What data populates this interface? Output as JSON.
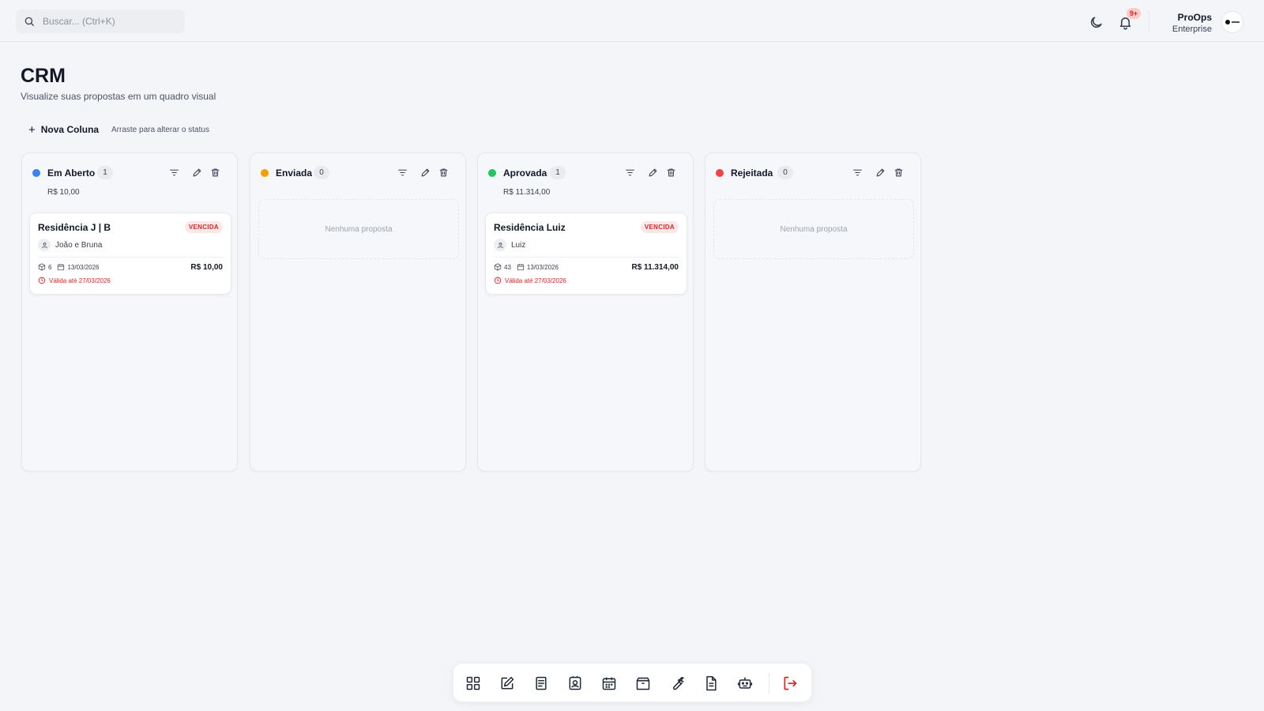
{
  "search": {
    "placeholder": "Buscar... (Ctrl+K)",
    "icon": "search-icon"
  },
  "topbar": {
    "notifications_badge": "9+",
    "user_name": "ProOps",
    "user_plan": "Enterprise"
  },
  "header": {
    "title": "CRM",
    "subtitle": "Visualize suas propostas em um quadro visual",
    "new_column_label": "Nova Coluna",
    "drag_hint": "Arraste para alterar o status"
  },
  "columns": [
    {
      "title": "Em Aberto",
      "count": "1",
      "total": "R$ 10,00",
      "color": "#3b82f6",
      "cards": [
        {
          "title": "Residência J | B",
          "tag": "VENCIDA",
          "client": "João e Bruna",
          "items": "6",
          "date": "13/03/2026",
          "price": "R$ 10,00",
          "valid": "Válida até 27/03/2026"
        }
      ]
    },
    {
      "title": "Enviada",
      "count": "0",
      "total": "",
      "color": "#f59e0b",
      "empty": "Nenhuma proposta",
      "cards": []
    },
    {
      "title": "Aprovada",
      "count": "1",
      "total": "R$ 11.314,00",
      "color": "#22c55e",
      "cards": [
        {
          "title": "Residência Luiz",
          "tag": "VENCIDA",
          "client": "Luiz",
          "items": "43",
          "date": "13/03/2026",
          "price": "R$ 11.314,00",
          "valid": "Válida até 27/03/2026"
        }
      ]
    },
    {
      "title": "Rejeitada",
      "count": "0",
      "total": "",
      "color": "#ef4444",
      "empty": "Nenhuma proposta",
      "cards": []
    }
  ],
  "colors": {
    "background": "#f4f5f8",
    "danger": "#dc2626",
    "text": "#111827"
  },
  "dock": {
    "items": [
      "dashboard-icon",
      "edit-icon",
      "document-icon",
      "contacts-icon",
      "calendar-icon",
      "package-icon",
      "wrench-icon",
      "report-icon",
      "robot-icon"
    ],
    "logout": "logout-icon"
  }
}
